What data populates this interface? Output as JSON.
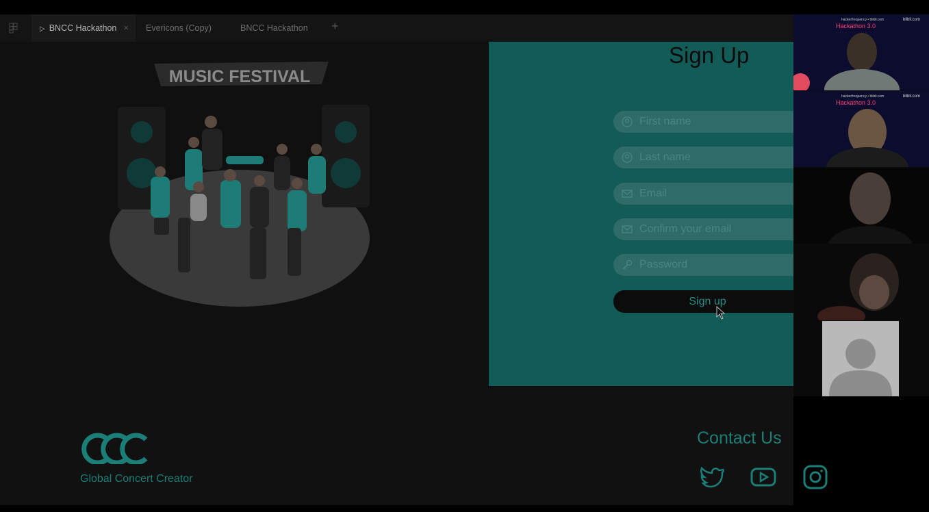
{
  "tabs": [
    {
      "label": "BNCC Hackathon",
      "active": true
    },
    {
      "label": "Evericons (Copy)",
      "active": false
    },
    {
      "label": "BNCC Hackathon",
      "active": false
    }
  ],
  "tab_add_label": "+",
  "illustration": {
    "banner_text": "MUSIC FESTIVAL"
  },
  "signup": {
    "title": "Sign Up",
    "fields": [
      {
        "placeholder": "First name",
        "icon": "user-icon"
      },
      {
        "placeholder": "Last name",
        "icon": "user-icon"
      },
      {
        "placeholder": "Email",
        "icon": "mail-icon"
      },
      {
        "placeholder": "Confirm your email",
        "icon": "mail-icon"
      },
      {
        "placeholder": "Password",
        "icon": "key-icon"
      }
    ],
    "button_label": "Sign up"
  },
  "footer": {
    "logo_text": "GCC",
    "tagline": "Global Concert Creator",
    "contact_title": "Contact Us",
    "social": [
      "twitter-icon",
      "youtube-icon",
      "instagram-icon"
    ]
  },
  "video_call": {
    "event_top": "hackerfrequency • blibli.com",
    "event_title": "Hackathon 3.0",
    "brand": "blibli.com"
  },
  "colors": {
    "teal": "#1b7e77",
    "panel": "#135b57"
  }
}
